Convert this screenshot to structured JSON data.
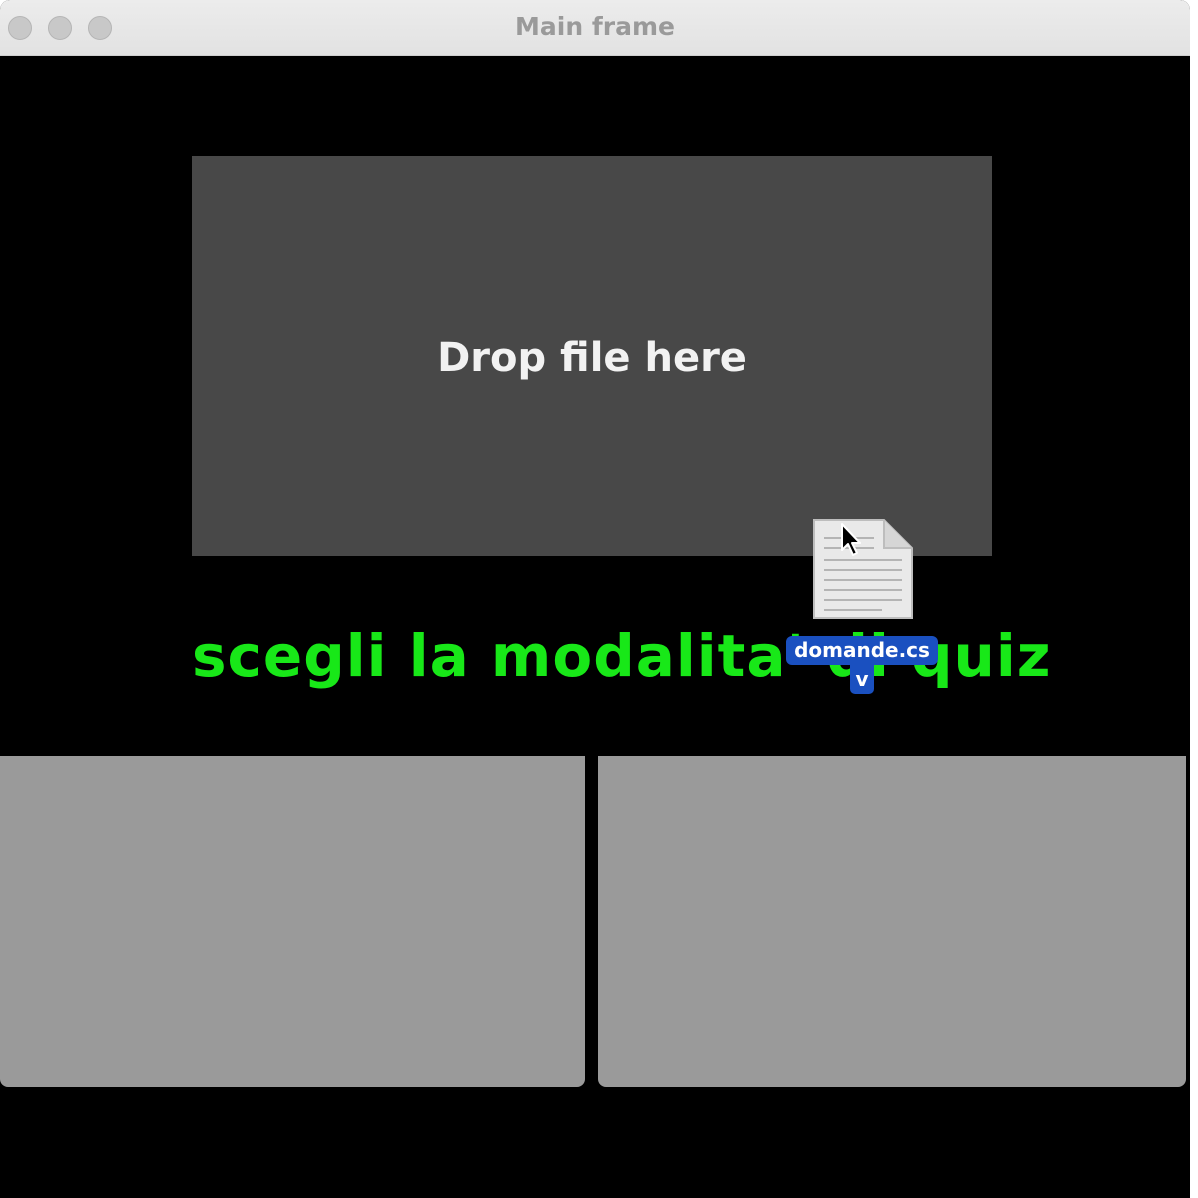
{
  "window": {
    "title": "Main frame"
  },
  "drop_zone": {
    "label": "Drop file here"
  },
  "mode_selection": {
    "heading": "scegli la modalita' di quiz",
    "options": [
      {
        "label": ""
      },
      {
        "label": ""
      }
    ]
  },
  "drag_ghost": {
    "file_name_line1": "domande.cs",
    "file_name_line2": "v",
    "icon": "document-icon"
  },
  "colors": {
    "background": "#000000",
    "drop_zone": "#484848",
    "heading": "#18e818",
    "mode_button": "#9a9a9a",
    "file_label": "#1a50c0"
  }
}
